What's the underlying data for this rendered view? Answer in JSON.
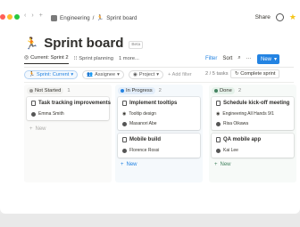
{
  "titlebar": {
    "breadcrumb_parent": "Engineering",
    "breadcrumb_sep": "/",
    "breadcrumb_page": "Sprint board",
    "share_label": "Share",
    "back_glyph": "‹",
    "forward_glyph": "›",
    "add_glyph": "+"
  },
  "page": {
    "title": "Sprint board",
    "badge": "Beta",
    "title_icon": "runner-icon"
  },
  "tabs": [
    {
      "label": "Current: Sprint 2",
      "icon": "target-icon"
    },
    {
      "label": "Sprint planning",
      "icon": "list-icon"
    },
    {
      "label": "1 more...",
      "icon": ""
    }
  ],
  "tools": {
    "filter_label": "Filter",
    "sort_label": "Sort",
    "new_label": "New"
  },
  "filters": {
    "sprint": "Sprint: Current",
    "assignee": "Assignee",
    "project": "Project",
    "add_filter": "+ Add filter",
    "task_count": "2 / 5 tasks",
    "complete_label": "Complete sprint"
  },
  "columns": [
    {
      "status": "Not Started",
      "count": "1",
      "dot_color": "#9b9a97",
      "pill_bg": "#f1f1ef",
      "col_bg": "#fafaf9",
      "new_color": "#acaba9",
      "cards": [
        {
          "title": "Task tracking improvements",
          "lines": [
            "Emma Smith"
          ]
        }
      ],
      "new_label": "New"
    },
    {
      "status": "In Progress",
      "count": "2",
      "dot_color": "#2383e2",
      "pill_bg": "#e3eefa",
      "col_bg": "#f5f9fc",
      "new_color": "#2383e2",
      "cards": [
        {
          "title": "Implement tooltips",
          "lines": [
            "Tooltip design",
            "Masanori Abe"
          ]
        },
        {
          "title": "Mobile build",
          "lines": [
            "Florence Rossi"
          ]
        }
      ],
      "new_label": "New"
    },
    {
      "status": "Done",
      "count": "2",
      "dot_color": "#448361",
      "pill_bg": "#e5f2ea",
      "col_bg": "#f7faf8",
      "new_color": "#448361",
      "cards": [
        {
          "title": "Schedule kick-off meeting",
          "lines": [
            "Engineering All Hands 9/1",
            "Risa Oikawa"
          ]
        },
        {
          "title": "QA mobile app",
          "lines": [
            "Kai Lee"
          ]
        }
      ],
      "new_label": "New"
    }
  ]
}
